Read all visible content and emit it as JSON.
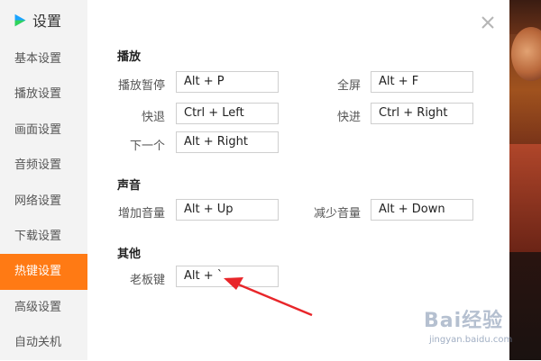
{
  "window": {
    "title": "设置"
  },
  "sidebar": {
    "items": [
      {
        "label": "基本设置"
      },
      {
        "label": "播放设置"
      },
      {
        "label": "画面设置"
      },
      {
        "label": "音频设置"
      },
      {
        "label": "网络设置"
      },
      {
        "label": "下载设置"
      },
      {
        "label": "热键设置"
      },
      {
        "label": "高级设置"
      },
      {
        "label": "自动关机"
      }
    ],
    "active_index": 6
  },
  "sections": {
    "play": {
      "title": "播放",
      "rows": [
        {
          "label": "播放暂停",
          "value": "Alt + P"
        },
        {
          "label": "全屏",
          "value": "Alt + F"
        },
        {
          "label": "快退",
          "value": "Ctrl + Left"
        },
        {
          "label": "快进",
          "value": "Ctrl + Right"
        },
        {
          "label": "下一个",
          "value": "Alt + Right"
        }
      ]
    },
    "sound": {
      "title": "声音",
      "rows": [
        {
          "label": "增加音量",
          "value": "Alt + Up"
        },
        {
          "label": "减少音量",
          "value": "Alt + Down"
        }
      ]
    },
    "other": {
      "title": "其他",
      "rows": [
        {
          "label": "老板键",
          "value": "Alt + `"
        }
      ]
    }
  },
  "watermark": {
    "logo": "Bai经验",
    "url": "jingyan.baidu.com"
  },
  "colors": {
    "accent": "#ff7a14",
    "arrow": "#e8262a",
    "logo_blue": "#1aa3ff",
    "logo_green": "#2fd35a"
  },
  "icons": {
    "close": "close-icon",
    "logo": "play-logo-icon",
    "annotation": "red-arrow"
  }
}
